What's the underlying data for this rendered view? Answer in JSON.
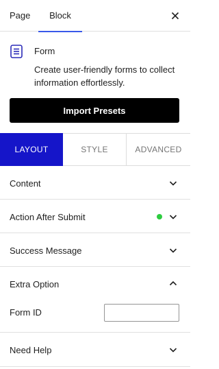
{
  "header": {
    "tabs": [
      {
        "label": "Page"
      },
      {
        "label": "Block"
      }
    ]
  },
  "block": {
    "title": "Form",
    "description": "Create user-friendly forms to collect information effortlessly."
  },
  "import_label": "Import Presets",
  "form_tabs": [
    {
      "label": "LAYOUT"
    },
    {
      "label": "STYLE"
    },
    {
      "label": "ADVANCED"
    }
  ],
  "panels": [
    {
      "title": "Content"
    },
    {
      "title": "Action After Submit"
    },
    {
      "title": "Success Message"
    },
    {
      "title": "Extra Option"
    },
    {
      "title": "Need Help"
    }
  ],
  "extra_option": {
    "form_id_label": "Form ID",
    "form_id_value": ""
  },
  "colors": {
    "active_tab": "#1515c9",
    "tab_underline": "#3858e9",
    "status_dot": "#2ecc40",
    "button_bg": "#000000"
  }
}
